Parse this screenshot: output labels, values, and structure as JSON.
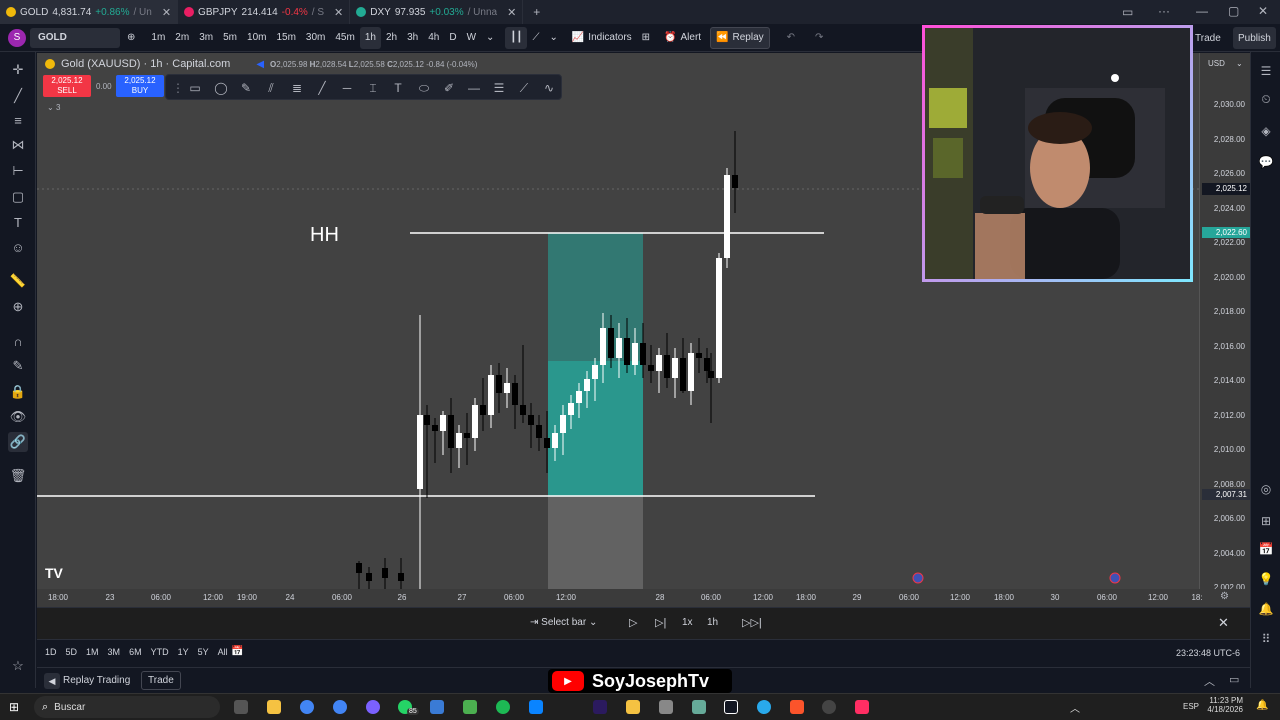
{
  "tabs": [
    {
      "symbol": "GOLD",
      "price": "4,831.74",
      "change": "+0.86%",
      "suffix": "/ Un",
      "active": true
    },
    {
      "symbol": "GBPJPY",
      "price": "214.414",
      "change": "-0.4%",
      "suffix": "/ S",
      "active": false
    },
    {
      "symbol": "DXY",
      "price": "97.935",
      "change": "+0.03%",
      "suffix": "/ Unna",
      "active": false
    }
  ],
  "toolbar": {
    "avatar_letter": "S",
    "symbol": "GOLD",
    "intervals": [
      "1m",
      "2m",
      "3m",
      "5m",
      "10m",
      "15m",
      "30m",
      "45m",
      "1h",
      "2h",
      "3h",
      "4h",
      "D",
      "W"
    ],
    "selected_interval": "1h",
    "indicators_label": "Indicators",
    "alert_label": "Alert",
    "replay_label": "Replay",
    "trade_label": "Trade",
    "publish_label": "Publish"
  },
  "legend": {
    "title": "Gold (XAUUSD) · 1h · Capital.com",
    "o_label": "O",
    "o_value": "2,025.98",
    "h_label": "H",
    "h_value": "2,028.54",
    "l_label": "L",
    "l_value": "2,025.58",
    "c_label": "C",
    "c_value": "2,025.12",
    "change": "-0.84 (-0.04%)",
    "sell_price": "2,025.12",
    "sell_label": "SELL",
    "spread": "0.00",
    "buy_price": "2,025.12",
    "buy_label": "BUY",
    "indicator_count": "3"
  },
  "chart": {
    "annotation_text": "HH",
    "currency": "USD",
    "price_labels": [
      "2,030.00",
      "2,028.00",
      "2,026.00",
      "2,024.00",
      "2,022.00",
      "2,020.00",
      "2,018.00",
      "2,016.00",
      "2,014.00",
      "2,012.00",
      "2,010.00",
      "2,008.00",
      "2,006.00",
      "2,004.00",
      "2,002.00"
    ],
    "current_price_label": "2,025.12",
    "hh_price_label": "2,022.60",
    "low_line_label": "2,007.31",
    "time_labels": [
      "18:00",
      "23",
      "06:00",
      "12:00",
      "19:00",
      "24",
      "06:00",
      "26",
      "27",
      "06:00",
      "12:00",
      "28",
      "06:00",
      "12:00",
      "18:00",
      "29",
      "06:00",
      "12:00",
      "18:00",
      "30",
      "06:00",
      "12:00",
      "18:"
    ],
    "colors": {
      "up": "#ffffff",
      "down": "#000000",
      "zone": "#26a69a",
      "bg": "#424242"
    }
  },
  "replay": {
    "select_bar": "Select bar",
    "speed": "1x",
    "interval": "1h"
  },
  "ranges": [
    "1D",
    "5D",
    "1M",
    "3M",
    "6M",
    "YTD",
    "1Y",
    "5Y",
    "All"
  ],
  "clock": "23:23:48 UTC-6",
  "bottom": {
    "replay_trading": "Replay Trading",
    "trade": "Trade"
  },
  "banner": {
    "channel": "SoyJosephTv"
  },
  "taskbar": {
    "search": "Buscar",
    "lang": "ESP",
    "time": "11:23 PM",
    "date": "4/18/2026",
    "badge": "85"
  }
}
